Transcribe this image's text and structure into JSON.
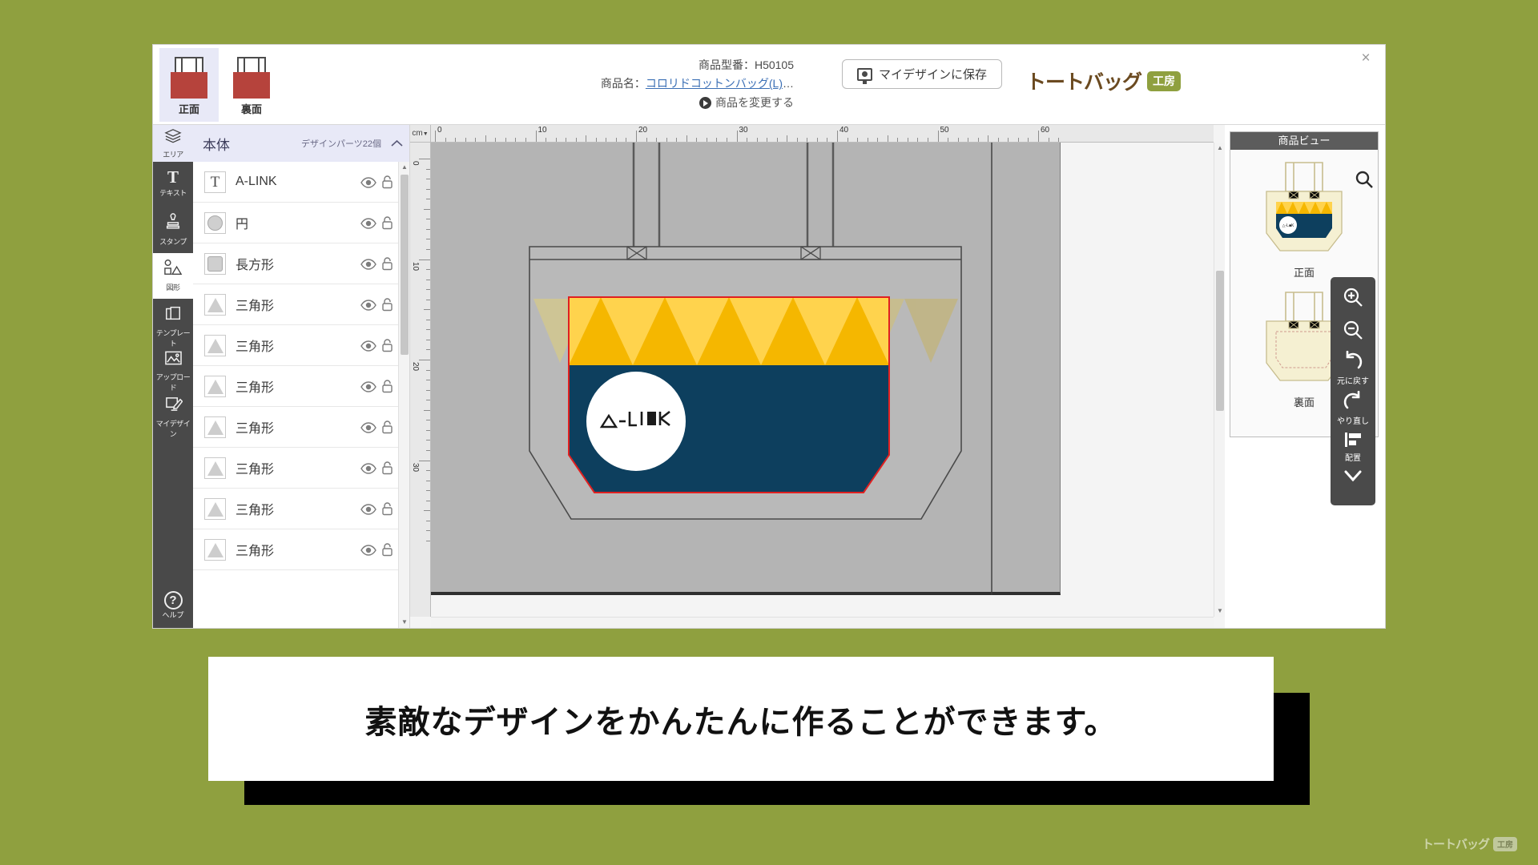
{
  "app": {
    "close_label": "×",
    "brand": {
      "text": "トートバッグ",
      "badge": "工房"
    }
  },
  "view_tabs": [
    {
      "id": "front",
      "label": "正面",
      "active": true
    },
    {
      "id": "back",
      "label": "裏面",
      "active": false
    }
  ],
  "product": {
    "model_label": "商品型番：H50105",
    "name_label": "商品名：",
    "name_link": "コロリドコットンバッグ(L)",
    "name_ellipsis": "…",
    "change_link": "商品を変更する"
  },
  "save_button": {
    "label": "マイデザインに保存",
    "icon": "monitor-save-icon"
  },
  "tool_rail": [
    {
      "id": "area",
      "label": "エリア",
      "glyph": "layers-icon",
      "active": true
    },
    {
      "id": "text",
      "label": "テキスト",
      "glyph": "T",
      "active": false
    },
    {
      "id": "stamp",
      "label": "スタンプ",
      "glyph": "stamp-icon",
      "active": false
    },
    {
      "id": "shape",
      "label": "図形",
      "glyph": "shapes-icon",
      "active": true
    },
    {
      "id": "template",
      "label": "テンプレート",
      "glyph": "copies-icon",
      "active": false
    },
    {
      "id": "upload",
      "label": "アップロード",
      "glyph": "image-icon",
      "active": false
    },
    {
      "id": "mydesign",
      "label": "マイデザイン",
      "glyph": "pen-screen-icon",
      "active": false
    }
  ],
  "help": {
    "label": "ヘルプ",
    "glyph": "?"
  },
  "layer_panel": {
    "title": "本体",
    "count_label": "デザインパーツ22個",
    "collapse_icon": "chevron-up-icon",
    "rows": [
      {
        "type": "text",
        "name": "A-LINK"
      },
      {
        "type": "circle",
        "name": "円"
      },
      {
        "type": "rect",
        "name": "長方形"
      },
      {
        "type": "triangle",
        "name": "三角形"
      },
      {
        "type": "triangle",
        "name": "三角形"
      },
      {
        "type": "triangle",
        "name": "三角形"
      },
      {
        "type": "triangle",
        "name": "三角形"
      },
      {
        "type": "triangle",
        "name": "三角形"
      },
      {
        "type": "triangle",
        "name": "三角形"
      },
      {
        "type": "triangle",
        "name": "三角形"
      }
    ]
  },
  "ruler": {
    "unit": "cm",
    "h_labels": [
      "0",
      "10",
      "20",
      "30",
      "40",
      "50",
      "60"
    ],
    "v_labels": [
      "0",
      "10",
      "20",
      "30"
    ]
  },
  "preview": {
    "title": "商品ビュー",
    "items": [
      {
        "label": "正面",
        "has_design": true
      },
      {
        "label": "裏面",
        "has_design": false
      }
    ],
    "zoom_icon": "magnifier-icon"
  },
  "float_tools": [
    {
      "id": "zoom-in",
      "label": "",
      "icon": "zoom-in-icon"
    },
    {
      "id": "zoom-out",
      "label": "",
      "icon": "zoom-out-icon"
    },
    {
      "id": "undo",
      "label": "元に戻す",
      "icon": "undo-icon"
    },
    {
      "id": "redo",
      "label": "やり直し",
      "icon": "redo-icon"
    },
    {
      "id": "align",
      "label": "配置",
      "icon": "align-icon"
    },
    {
      "id": "more",
      "label": "",
      "icon": "chevron-down-icon"
    }
  ],
  "canvas_design": {
    "logo_text": "△-L■K",
    "colors": {
      "navy": "#0d3f5e",
      "yellow_light": "#ffd34d",
      "yellow_dark": "#f5b700",
      "selection": "#e02020",
      "bag_body": "#b4b4b4"
    },
    "triangle_count": 5
  },
  "caption": {
    "text": "素敵なデザインをかんたんに作ることができます。"
  },
  "watermark": {
    "text": "トートバッグ",
    "badge": "工房"
  }
}
